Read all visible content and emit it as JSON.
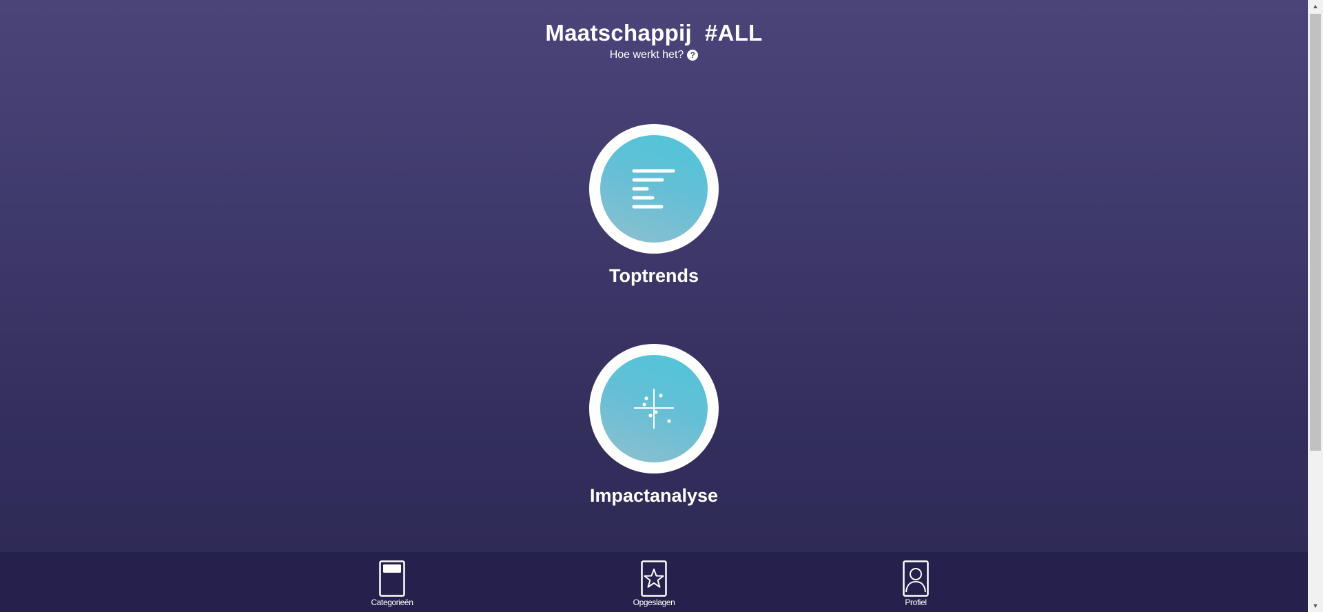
{
  "header": {
    "title": "Maatschappij  #ALL",
    "help_label": "Hoe werkt het?",
    "help_icon": "question-circle-icon"
  },
  "tiles": [
    {
      "label": "Toptrends",
      "icon": "bar-list-icon"
    },
    {
      "label": "Impactanalyse",
      "icon": "scatter-quadrant-icon"
    }
  ],
  "bottom_nav": [
    {
      "label": "Categorieën",
      "icon": "card-category-icon"
    },
    {
      "label": "Opgeslagen",
      "icon": "star-card-icon"
    },
    {
      "label": "Profiel",
      "icon": "profile-card-icon"
    }
  ],
  "colors": {
    "background_top": "#4b4479",
    "background_bottom": "#2d2954",
    "bottom_bar": "#26214c",
    "disc_accent": "#4fc6d9"
  }
}
